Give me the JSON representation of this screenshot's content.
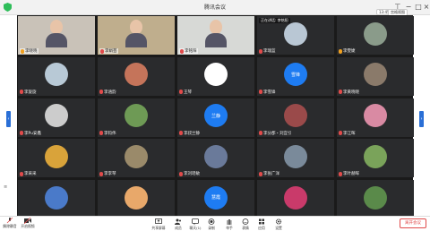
{
  "window": {
    "title": "腾讯会议"
  },
  "top": {
    "clock": "13:45",
    "layout_label": "宫格视图"
  },
  "tiles": [
    {
      "name": "李晓晓",
      "kind": "video",
      "bg": "#c9c2b8",
      "host": true
    },
    {
      "name": "李娟芸",
      "kind": "video",
      "bg": "#bfae8d",
      "host": false
    },
    {
      "name": "李铭阳",
      "kind": "video",
      "bg": "#d7d9d6",
      "host": false
    },
    {
      "name": "李瑞蓝",
      "kind": "avatar",
      "bg": "#b9c7d4",
      "host": false,
      "caption": "正在讲话: 李铭阳"
    },
    {
      "name": "李雯婕",
      "kind": "avatar",
      "bg": "#8a9b8a",
      "host": true
    },
    {
      "name": "李旋旋",
      "kind": "avatar",
      "bg": "#b8c9d6"
    },
    {
      "name": "李涵韵",
      "kind": "avatar",
      "bg": "#c5745a"
    },
    {
      "name": "王琴",
      "kind": "avatar",
      "bg": "#ffffff"
    },
    {
      "name": "李雪锋",
      "kind": "initial",
      "bg": "#1e7cf2",
      "initial": "雪锋"
    },
    {
      "name": "李黄晓晓",
      "kind": "avatar",
      "bg": "#8a7a6a"
    },
    {
      "name": "李Pu安鑫",
      "kind": "avatar",
      "bg": "#cccccc"
    },
    {
      "name": "李钧伟",
      "kind": "avatar",
      "bg": "#6e9a55"
    },
    {
      "name": "李叔兰静",
      "kind": "initial",
      "bg": "#1e7cf2",
      "initial": "兰静"
    },
    {
      "name": "李分郡・刘宜引",
      "kind": "avatar",
      "bg": "#9a4a4a"
    },
    {
      "name": "李江晖",
      "kind": "avatar",
      "bg": "#d98aa3"
    },
    {
      "name": "李采采",
      "kind": "avatar",
      "bg": "#d9a33a"
    },
    {
      "name": "李李琴",
      "kind": "avatar",
      "bg": "#9a8a6a"
    },
    {
      "name": "李刘瑶敏",
      "kind": "avatar",
      "bg": "#6a7a9a"
    },
    {
      "name": "李张广洋",
      "kind": "avatar",
      "bg": "#7a8a9a"
    },
    {
      "name": "李叶赫晖",
      "kind": "avatar",
      "bg": "#7aa35a"
    },
    {
      "name": "",
      "kind": "avatar",
      "bg": "#4a7ac9"
    },
    {
      "name": "",
      "kind": "avatar",
      "bg": "#e8a86a"
    },
    {
      "name": "",
      "kind": "initial",
      "bg": "#1e7cf2",
      "initial": "慧霞"
    },
    {
      "name": "",
      "kind": "avatar",
      "bg": "#c93a6a"
    },
    {
      "name": "",
      "kind": "avatar",
      "bg": "#5a8a4a"
    }
  ],
  "bottom": {
    "left": [
      {
        "label": "解除静音"
      },
      {
        "label": "开启视频"
      }
    ],
    "items": [
      {
        "label": "共享屏幕"
      },
      {
        "label": "成员"
      },
      {
        "label": "聊天(1)"
      },
      {
        "label": "录制"
      },
      {
        "label": "举手"
      },
      {
        "label": "表情"
      },
      {
        "label": "应用"
      },
      {
        "label": "设置"
      }
    ],
    "end_label": "离开会议"
  }
}
